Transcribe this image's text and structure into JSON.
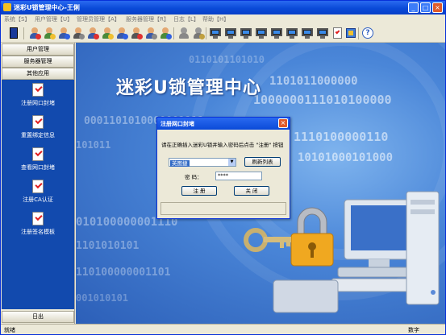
{
  "window": {
    "title": "迷彩U锁管理中心-王俐"
  },
  "menu": [
    "系统【S】",
    "用户管理【U】",
    "管理员管理【A】",
    "服务器管理【R】",
    "日志【L】",
    "帮助【H】"
  ],
  "sidebar": {
    "user_mgmt": "用户管理",
    "server_mgmt": "服务器管理",
    "other_apps": "其他应用",
    "items": [
      {
        "label": "注册网口封堵"
      },
      {
        "label": "重置绑定信息"
      },
      {
        "label": "查看网口封堵"
      },
      {
        "label": "注册CA认证"
      },
      {
        "label": "注册签名模板"
      }
    ],
    "logout": "日出"
  },
  "main": {
    "banner_title": "迷彩U锁管理中心"
  },
  "dialog": {
    "title": "注册网口封堵",
    "message": "请在正确插入迷彩U锁并输入密码后点击 \"注册\" 按钮",
    "device": "英图捷",
    "refresh_label": "刷新列表",
    "password_label": "密 码：",
    "password_value": "****",
    "register_label": "注 册",
    "close_label": "关 闭"
  },
  "status": {
    "left": "就绪",
    "right": "数字"
  },
  "colors": {
    "title_bar": "#0a4ad8",
    "side_panel": "#124aae",
    "close_button": "#e05a2a"
  }
}
